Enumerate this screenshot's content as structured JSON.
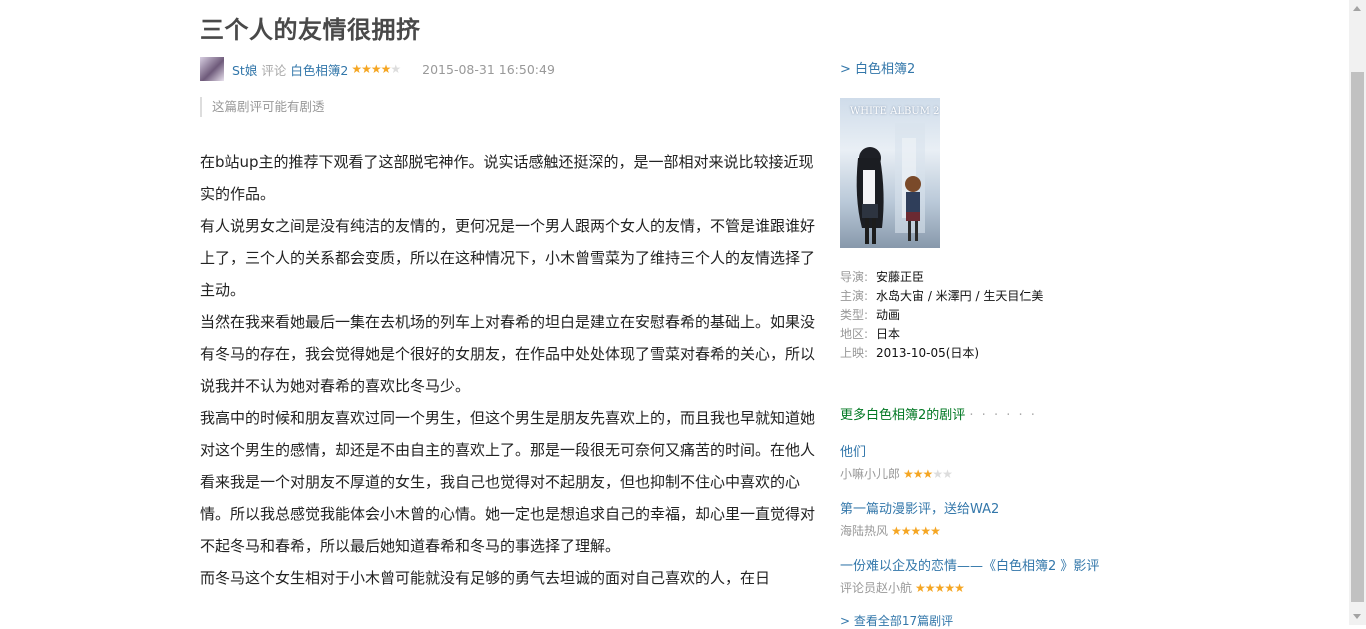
{
  "review": {
    "title": "三个人的友情很拥挤",
    "author": "St娘",
    "action": "评论",
    "subject": "白色相簿2",
    "rating": 4,
    "rating_max": 5,
    "time": "2015-08-31 16:50:49",
    "spoiler_notice": "这篇剧评可能有剧透",
    "paragraphs": [
      "在b站up主的推荐下观看了这部脱宅神作。说实话感触还挺深的，是一部相对来说比较接近现实的作品。",
      "有人说男女之间是没有纯洁的友情的，更何况是一个男人跟两个女人的友情，不管是谁跟谁好上了，三个人的关系都会变质，所以在这种情况下，小木曾雪菜为了维持三个人的友情选择了主动。",
      "当然在我来看她最后一集在去机场的列车上对春希的坦白是建立在安慰春希的基础上。如果没有冬马的存在，我会觉得她是个很好的女朋友，在作品中处处体现了雪菜对春希的关心，所以说我并不认为她对春希的喜欢比冬马少。",
      "我高中的时候和朋友喜欢过同一个男生，但这个男生是朋友先喜欢上的，而且我也早就知道她对这个男生的感情，却还是不由自主的喜欢上了。那是一段很无可奈何又痛苦的时间。在他人看来我是一个对朋友不厚道的女生，我自己也觉得对不起朋友，但也抑制不住心中喜欢的心情。所以我总感觉我能体会小木曾的心情。她一定也是想追求自己的幸福，却心里一直觉得对不起冬马和春希，所以最后她知道春希和冬马的事选择了理解。",
      "而冬马这个女生相对于小木曾可能就没有足够的勇气去坦诚的面对自己喜欢的人，在日"
    ]
  },
  "sidebar": {
    "subject_link": "> 白色相簿2",
    "poster_title": "WHITE ALBUM 2",
    "info": [
      {
        "label": "导演:",
        "value": "安藤正臣"
      },
      {
        "label": "主演:",
        "value": "水岛大宙 / 米澤円 / 生天目仁美"
      },
      {
        "label": "类型:",
        "value": "动画"
      },
      {
        "label": "地区:",
        "value": "日本"
      },
      {
        "label": "上映:",
        "value": "2013-10-05(日本)"
      }
    ],
    "more_title": "更多白色相簿2的剧评",
    "more_dots": "· · · · · ·",
    "reviews": [
      {
        "title": "他们",
        "author": "小嘛小儿郎",
        "rating": 3
      },
      {
        "title": "第一篇动漫影评，送给WA2",
        "author": "海陆热风",
        "rating": 5
      },
      {
        "title": "一份难以企及的恋情——《白色相簿2 》影评",
        "author": "评论员赵小航",
        "rating": 5
      }
    ],
    "view_all": "> 查看全部17篇剧评"
  },
  "colors": {
    "link": "#3377aa",
    "star": "#f5a623",
    "more_title": "#007722"
  }
}
